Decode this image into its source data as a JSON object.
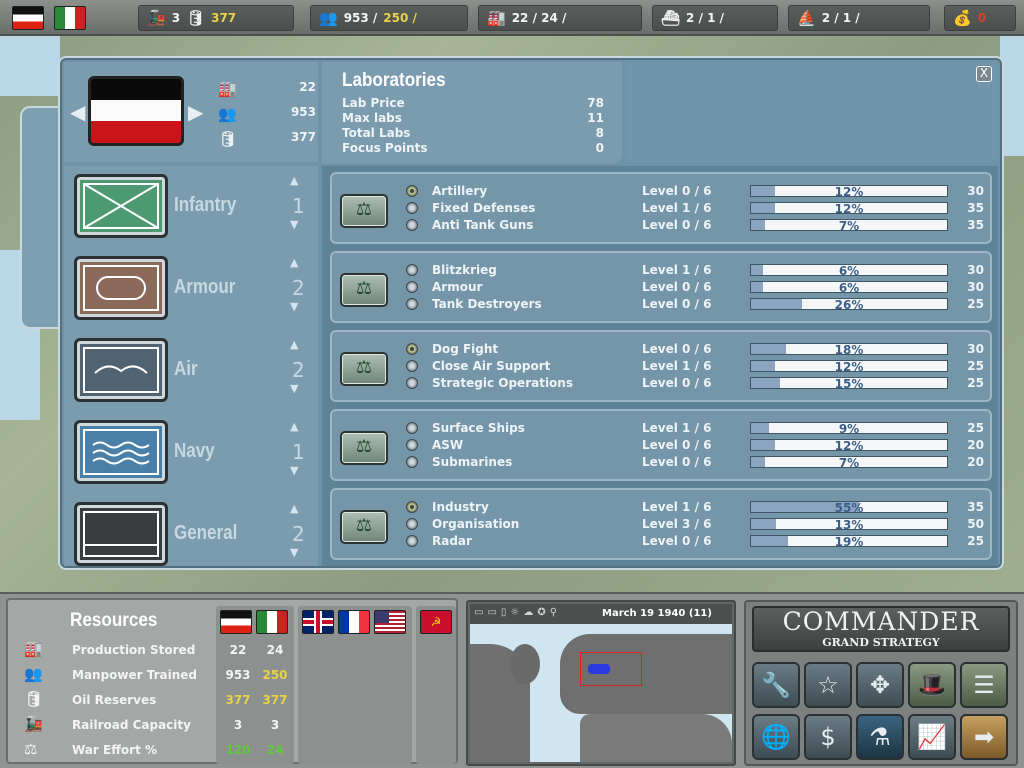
{
  "topbar": {
    "rail_value": "3",
    "oil_value": "377",
    "manpower": "953 /",
    "manpower_yellow": "250 /",
    "production": "22 / 24 /",
    "naval_surface": "2 /  1 /",
    "naval_sub": "2 /  1 /",
    "treasury": "0"
  },
  "header": {
    "production": "22",
    "manpower": "953",
    "oil": "377"
  },
  "labs": {
    "title": "Laboratories",
    "rows": [
      {
        "label": "Lab Price",
        "value": "78"
      },
      {
        "label": "Max labs",
        "value": "11"
      },
      {
        "label": "Total Labs",
        "value": "8"
      },
      {
        "label": "Focus Points",
        "value": "0"
      }
    ]
  },
  "close_label": "X",
  "categories": [
    {
      "name": "Infantry",
      "count": "1"
    },
    {
      "name": "Armour",
      "count": "2"
    },
    {
      "name": "Air",
      "count": "2"
    },
    {
      "name": "Navy",
      "count": "1"
    },
    {
      "name": "General",
      "count": "2"
    }
  ],
  "tech_groups": [
    {
      "techs": [
        {
          "name": "Artillery",
          "level": "Level 0 /  6",
          "percent": "12%",
          "progress": 0.12,
          "cost": "30",
          "active": true
        },
        {
          "name": "Fixed Defenses",
          "level": "Level 1 /  6",
          "percent": "12%",
          "progress": 0.12,
          "cost": "35",
          "active": false
        },
        {
          "name": "Anti Tank Guns",
          "level": "Level 0 /  6",
          "percent": "7%",
          "progress": 0.07,
          "cost": "35",
          "active": false
        }
      ]
    },
    {
      "techs": [
        {
          "name": "Blitzkrieg",
          "level": "Level 1 /  6",
          "percent": "6%",
          "progress": 0.06,
          "cost": "30",
          "active": false
        },
        {
          "name": "Armour",
          "level": "Level 0 /  6",
          "percent": "6%",
          "progress": 0.06,
          "cost": "30",
          "active": false
        },
        {
          "name": "Tank Destroyers",
          "level": "Level 0 /  6",
          "percent": "26%",
          "progress": 0.26,
          "cost": "25",
          "active": false
        }
      ]
    },
    {
      "techs": [
        {
          "name": "Dog Fight",
          "level": "Level 0 /  6",
          "percent": "18%",
          "progress": 0.18,
          "cost": "30",
          "active": true
        },
        {
          "name": "Close Air Support",
          "level": "Level 1 /  6",
          "percent": "12%",
          "progress": 0.12,
          "cost": "25",
          "active": false
        },
        {
          "name": "Strategic Operations",
          "level": "Level 0 /  6",
          "percent": "15%",
          "progress": 0.15,
          "cost": "25",
          "active": false
        }
      ]
    },
    {
      "techs": [
        {
          "name": "Surface Ships",
          "level": "Level 1 /  6",
          "percent": "9%",
          "progress": 0.09,
          "cost": "25",
          "active": false
        },
        {
          "name": "ASW",
          "level": "Level 0 /  6",
          "percent": "12%",
          "progress": 0.12,
          "cost": "20",
          "active": false
        },
        {
          "name": "Submarines",
          "level": "Level 0 /  6",
          "percent": "7%",
          "progress": 0.07,
          "cost": "20",
          "active": false
        }
      ]
    },
    {
      "techs": [
        {
          "name": "Industry",
          "level": "Level 1 /  6",
          "percent": "55%",
          "progress": 0.55,
          "cost": "35",
          "active": true
        },
        {
          "name": "Organisation",
          "level": "Level 3 /  6",
          "percent": "13%",
          "progress": 0.13,
          "cost": "50",
          "active": false
        },
        {
          "name": "Radar",
          "level": "Level 0 /  6",
          "percent": "19%",
          "progress": 0.19,
          "cost": "25",
          "active": false
        }
      ]
    }
  ],
  "resources": {
    "title": "Resources",
    "rows": [
      {
        "label": "Production Stored",
        "v1": "22",
        "v2": "24",
        "c1": "#f4f4f4",
        "c2": "#f4f4f4",
        "icon": "factory-icon"
      },
      {
        "label": "Manpower Trained",
        "v1": "953",
        "v2": "250",
        "c1": "#f4f4f4",
        "c2": "#e8d24a",
        "icon": "soldiers-icon"
      },
      {
        "label": "Oil Reserves",
        "v1": "377",
        "v2": "377",
        "c1": "#e8d24a",
        "c2": "#e8d24a",
        "icon": "oil-barrels-icon"
      },
      {
        "label": "Railroad Capacity",
        "v1": "3",
        "v2": "3",
        "c1": "#f4f4f4",
        "c2": "#f4f4f4",
        "icon": "train-icon"
      },
      {
        "label": "War Effort %",
        "v1": "120",
        "v2": "24",
        "c1": "#5fc83a",
        "c2": "#5fc83a",
        "icon": "scales-icon"
      }
    ]
  },
  "minimap": {
    "date": "March 19 1940 (11)"
  },
  "commander": {
    "title": "COMMANDER",
    "subtitle": "GRAND STRATEGY"
  }
}
